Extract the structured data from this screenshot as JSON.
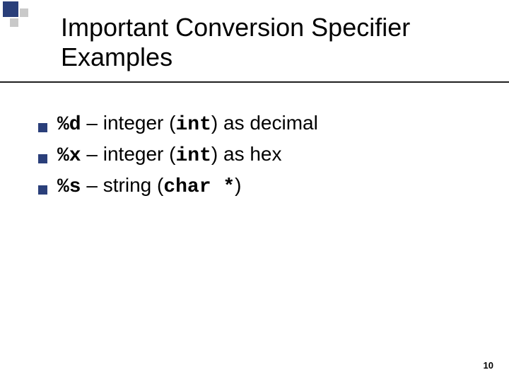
{
  "title_line1": "Important Conversion Specifier",
  "title_line2": "Examples",
  "bullets": [
    {
      "code": "%d",
      "mid": " – integer (",
      "type": "int",
      "tail": ") as decimal"
    },
    {
      "code": "%x",
      "mid": " – integer (",
      "type": "int",
      "tail": ") as hex"
    },
    {
      "code": "%s",
      "mid": " – string (",
      "type": "char *",
      "tail": ")"
    }
  ],
  "page_number": "10"
}
